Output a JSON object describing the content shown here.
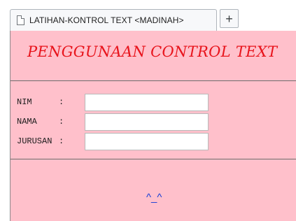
{
  "browser": {
    "tab_title": "LATIHAN-KONTROL TEXT <MADINAH>",
    "new_tab_label": "+"
  },
  "page": {
    "heading": "PENGGUNAAN CONTROL TEXT",
    "background_color": "#ffc0cb",
    "heading_color": "#e8141c",
    "footer_text": "^_^",
    "footer_color": "#1a3fd6"
  },
  "form": {
    "fields": [
      {
        "label": "NIM",
        "colon": ":",
        "value": "",
        "placeholder": ""
      },
      {
        "label": "NAMA",
        "colon": ":",
        "value": "",
        "placeholder": ""
      },
      {
        "label": "JURUSAN",
        "colon": ":",
        "value": "",
        "placeholder": ""
      }
    ]
  }
}
